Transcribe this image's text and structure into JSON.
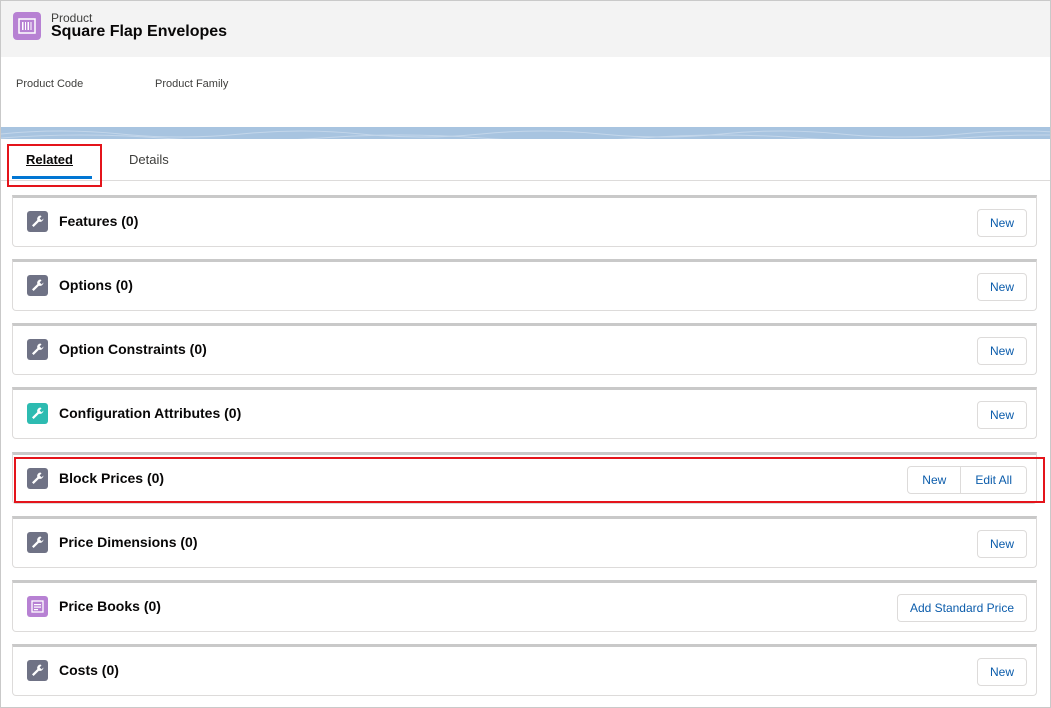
{
  "header": {
    "object_label": "Product",
    "record_title": "Square Flap Envelopes",
    "icon": "product-icon"
  },
  "fields": {
    "product_code_label": "Product Code",
    "product_family_label": "Product Family"
  },
  "tabs": [
    {
      "label": "Related",
      "active": true
    },
    {
      "label": "Details",
      "active": false
    }
  ],
  "related_lists": [
    {
      "title": "Features (0)",
      "icon": "wrench-icon",
      "buttons": [
        "New"
      ]
    },
    {
      "title": "Options (0)",
      "icon": "wrench-icon",
      "buttons": [
        "New"
      ]
    },
    {
      "title": "Option Constraints (0)",
      "icon": "wrench-icon",
      "buttons": [
        "New"
      ]
    },
    {
      "title": "Configuration Attributes (0)",
      "icon": "wrench-icon",
      "buttons": [
        "New"
      ]
    },
    {
      "title": "Block Prices (0)",
      "icon": "wrench-icon",
      "buttons": [
        "New",
        "Edit All"
      ]
    },
    {
      "title": "Price Dimensions (0)",
      "icon": "wrench-icon",
      "buttons": [
        "New"
      ]
    },
    {
      "title": "Price Books (0)",
      "icon": "pricebook-icon",
      "buttons": [
        "Add Standard Price"
      ]
    },
    {
      "title": "Costs (0)",
      "icon": "wrench-icon",
      "buttons": [
        "New"
      ]
    }
  ],
  "colors": {
    "accent": "#0176d3",
    "highlight": "#e4141b",
    "product_icon": "#b781d3",
    "wrench_icon": "#6f7285",
    "config_icon": "#2dbbb1"
  }
}
